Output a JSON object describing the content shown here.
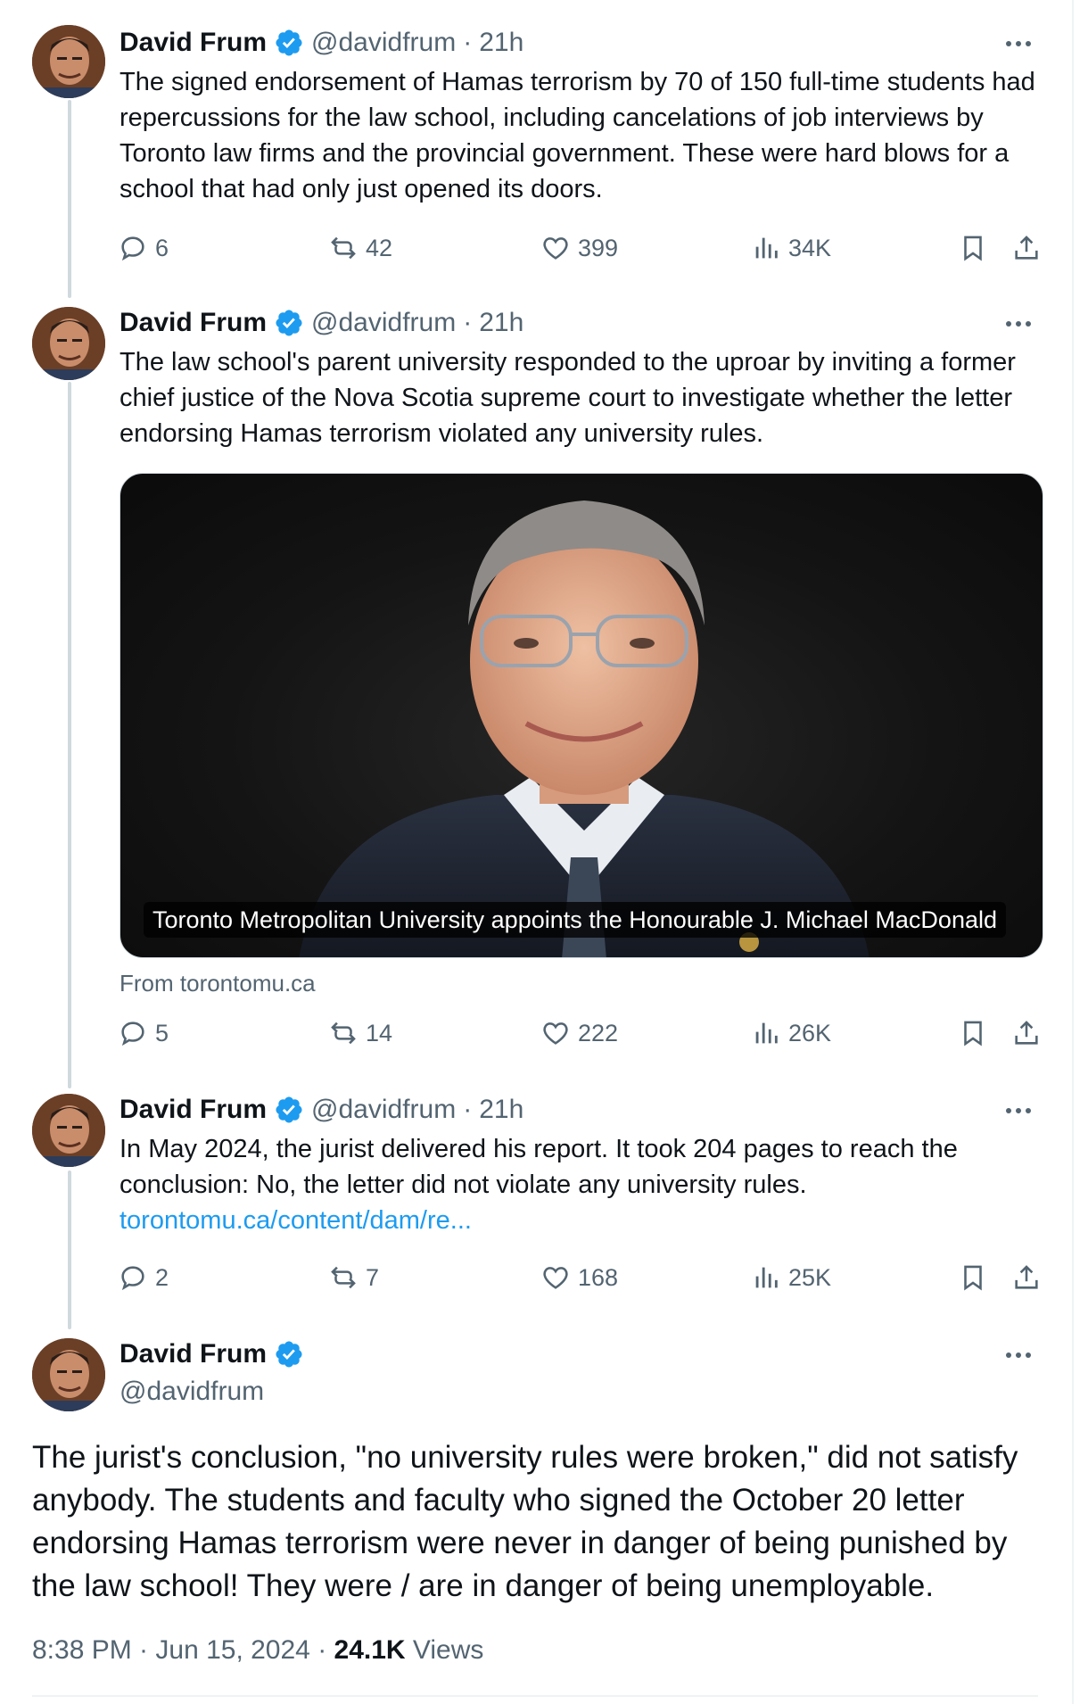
{
  "colors": {
    "accent": "#1d9bf0",
    "text": "#0f1419",
    "muted": "#536471"
  },
  "tweets": [
    {
      "name": "David Frum",
      "handle": "@davidfrum",
      "separator": "·",
      "time": "21h",
      "text": "The signed endorsement of Hamas terrorism by 70 of 150 full-time students had repercussions for the law school, including cancelations of job interviews by Toronto law firms and the provincial government. These were hard blows for a school that had only just opened its doors.",
      "replies": "6",
      "reposts": "42",
      "likes": "399",
      "views": "34K"
    },
    {
      "name": "David Frum",
      "handle": "@davidfrum",
      "separator": "·",
      "time": "21h",
      "text": "The law school's parent university responded to the uproar by inviting a former chief justice of the Nova Scotia supreme court to investigate whether the letter endorsing Hamas terrorism violated any university rules.",
      "media_caption": "Toronto Metropolitan University appoints the Honourable J. Michael MacDonald",
      "media_source": "From torontomu.ca",
      "replies": "5",
      "reposts": "14",
      "likes": "222",
      "views": "26K"
    },
    {
      "name": "David Frum",
      "handle": "@davidfrum",
      "separator": "·",
      "time": "21h",
      "text": "In May 2024, the jurist delivered his report. It took 204 pages to reach the conclusion: No, the letter did not violate any university rules.",
      "link": "torontomu.ca/content/dam/re...",
      "replies": "2",
      "reposts": "7",
      "likes": "168",
      "views": "25K"
    }
  ],
  "main_tweet": {
    "name": "David Frum",
    "handle": "@davidfrum",
    "text": "The jurist's conclusion, \"no university rules were broken,\" did not satisfy anybody. The students and faculty who signed the October 20 letter endorsing Hamas terrorism were never in danger of being punished by the law school! They were / are in danger of being unemployable.",
    "time": "8:38 PM · Jun 15, 2024 · ",
    "views_count": "24.1K",
    "views_label": " Views"
  }
}
